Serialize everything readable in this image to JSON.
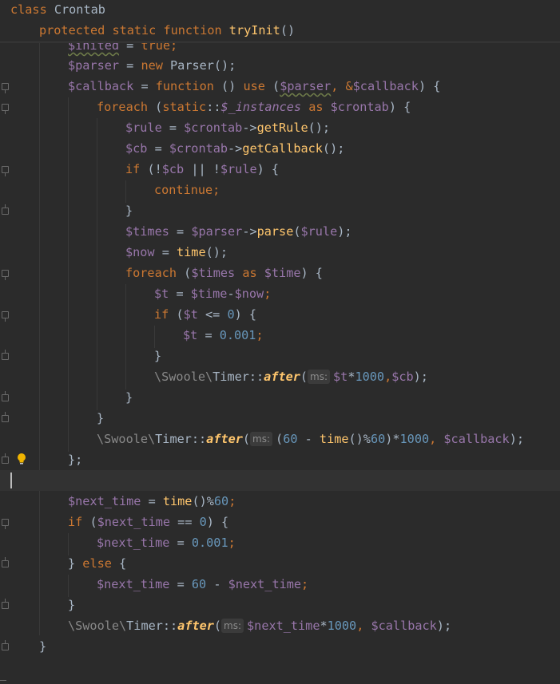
{
  "sticky_header": {
    "line1": {
      "kw": "class",
      "name": "Crontab"
    },
    "line2": {
      "kw1": "protected",
      "kw2": "static",
      "kw3": "function",
      "name": "tryInit",
      "paren": "()"
    }
  },
  "code": {
    "l_inited": {
      "var": "$inited",
      "op": " = ",
      "val": "true",
      "end": ";"
    },
    "l_parser": {
      "var": "$parser",
      "op": " = ",
      "kw": "new",
      "rest": " Parser();"
    },
    "l_callback": {
      "var": "$callback",
      "op": " = ",
      "kw": "function",
      "p1": " () ",
      "kw2": "use",
      "p2": " (",
      "v1": "$parser",
      "c": ", &",
      "v2": "$callback",
      "p3": ") {"
    },
    "l_foreach1": {
      "kw": "foreach",
      "p1": " (",
      "static": "static",
      "dc": "::",
      "inst": "$_instances",
      "as": " as ",
      "var": "$crontab",
      "p2": ") {"
    },
    "l_rule": {
      "var": "$rule",
      "op": " = ",
      "var2": "$crontab",
      "arrow": "->",
      "fn": "getRule",
      "end": "();"
    },
    "l_cb": {
      "var": "$cb",
      "op": " = ",
      "var2": "$crontab",
      "arrow": "->",
      "fn": "getCallback",
      "end": "();"
    },
    "l_if1": {
      "kw": "if",
      "p1": " (!",
      "v1": "$cb",
      "op": " || !",
      "v2": "$rule",
      "p2": ") {"
    },
    "l_continue": {
      "kw": "continue",
      "end": ";"
    },
    "l_close1": "}",
    "l_times": {
      "var": "$times",
      "op": " = ",
      "var2": "$parser",
      "arrow": "->",
      "fn": "parse",
      "p1": "(",
      "v3": "$rule",
      "end": ");"
    },
    "l_now": {
      "var": "$now",
      "op": " = ",
      "fn": "time",
      "end": "();"
    },
    "l_foreach2": {
      "kw": "foreach",
      "p1": " (",
      "v1": "$times",
      "as": " as ",
      "v2": "$time",
      "p2": ") {"
    },
    "l_t": {
      "var": "$t",
      "op": " = ",
      "v2": "$time",
      "minus": "-",
      "v3": "$now",
      "end": ";"
    },
    "l_if2": {
      "kw": "if",
      "p1": " (",
      "v1": "$t",
      "op": " <= ",
      "num": "0",
      "p2": ") {"
    },
    "l_tset": {
      "var": "$t",
      "op": " = ",
      "num": "0.001",
      "end": ";"
    },
    "l_close2": "}",
    "l_timer1": {
      "ns1": "\\Swoole\\",
      "cls": "Timer",
      "dc": "::",
      "fn": "after",
      "p1": "(",
      "hint": "ms:",
      "v1": "$t",
      "op": "*",
      "num": "1000",
      "c": ",",
      "v2": "$cb",
      "end": ");"
    },
    "l_close3": "}",
    "l_close4": "}",
    "l_timer2": {
      "ns1": "\\Swoole\\",
      "cls": "Timer",
      "dc": "::",
      "fn": "after",
      "p1": "(",
      "hint": "ms:",
      "p2": "(",
      "num1": "60",
      "op1": " - ",
      "fn2": "time",
      "p3": "()%",
      "num2": "60",
      "p4": ")*",
      "num3": "1000",
      "c": ", ",
      "v1": "$callback",
      "end": ");"
    },
    "l_close5": "};",
    "l_next1": {
      "var": "$next_time",
      "op": " = ",
      "fn": "time",
      "p1": "()%",
      "num": "60",
      "end": ";"
    },
    "l_if3": {
      "kw": "if",
      "p1": " (",
      "v1": "$next_time",
      "op": " == ",
      "num": "0",
      "p2": ") {"
    },
    "l_next2": {
      "var": "$next_time",
      "op": " = ",
      "num": "0.001",
      "end": ";"
    },
    "l_else": {
      "p1": "} ",
      "kw": "else",
      "p2": " {"
    },
    "l_next3": {
      "var": "$next_time",
      "op": " = ",
      "num": "60",
      "minus": " - ",
      "v2": "$next_time",
      "end": ";"
    },
    "l_close6": "}",
    "l_timer3": {
      "ns1": "\\Swoole\\",
      "cls": "Timer",
      "dc": "::",
      "fn": "after",
      "p1": "(",
      "hint": "ms:",
      "v1": "$next_time",
      "op": "*",
      "num": "1000",
      "c": ", ",
      "v2": "$callback",
      "end": ");"
    },
    "l_close7": "}"
  },
  "colors": {
    "background": "#2b2b2b",
    "keyword": "#cc7832",
    "variable": "#9876aa",
    "function": "#ffc66d",
    "number": "#6897bb",
    "text": "#a9b7c6"
  },
  "icons": {
    "intention": "lightbulb-icon",
    "fold": "fold-marker-icon"
  }
}
